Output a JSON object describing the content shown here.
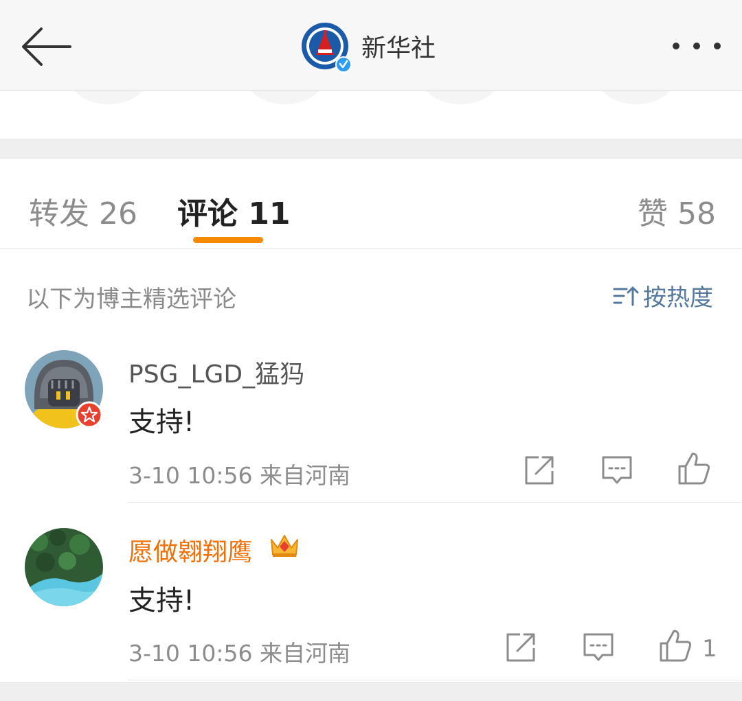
{
  "header": {
    "title": "新华社",
    "avatar_icon": "xinhua-logo-icon",
    "verified_icon": "verified-badge-icon",
    "back_icon": "back-arrow-icon",
    "more_icon": "more-dots-icon"
  },
  "tabs": [
    {
      "label": "转发 26",
      "active": false
    },
    {
      "label": "评论 11",
      "active": true
    },
    {
      "label": "赞 58",
      "active": false
    }
  ],
  "filter": {
    "label": "以下为博主精选评论",
    "sort_label": "按热度",
    "sort_icon": "sort-icon"
  },
  "comments": [
    {
      "username": "PSG_LGD_猛犸",
      "text": "支持!",
      "meta": "3-10 10:56  来自河南",
      "avatar_icon": "knight-avatar",
      "badge_icon": "star-badge-icon",
      "like_count": ""
    },
    {
      "username": "愿做翱翔鹰",
      "text": "支持!",
      "meta": "3-10 10:56  来自河南",
      "avatar_icon": "forest-lake-avatar",
      "badge_icon": "crown-vip-icon",
      "like_count": "1"
    }
  ],
  "colors": {
    "accent": "#f58a00",
    "vip_name": "#f0700a",
    "sort_link": "#55789e",
    "muted": "#8c8c8c"
  }
}
